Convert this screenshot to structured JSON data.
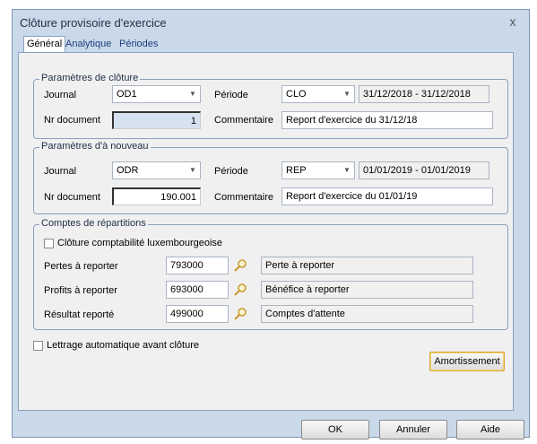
{
  "window": {
    "title": "Clôture provisoire d'exercice",
    "close": "x"
  },
  "tabs": [
    {
      "label": "Général",
      "active": true
    },
    {
      "label": "Analytique",
      "active": false
    },
    {
      "label": "Périodes",
      "active": false
    }
  ],
  "cloture": {
    "legend": "Paramètres de clôture",
    "journal_label": "Journal",
    "journal_value": "OD1",
    "periode_label": "Période",
    "periode_value": "CLO",
    "periode_range": "31/12/2018 - 31/12/2018",
    "nr_label": "Nr document",
    "nr_value": "1",
    "comment_label": "Commentaire",
    "comment_value": "Report d'exercice du 31/12/18"
  },
  "nouveau": {
    "legend": "Paramètres d'à nouveau",
    "journal_label": "Journal",
    "journal_value": "ODR",
    "periode_label": "Période",
    "periode_value": "REP",
    "periode_range": "01/01/2019 - 01/01/2019",
    "nr_label": "Nr document",
    "nr_value": "190.001",
    "comment_label": "Commentaire",
    "comment_value": "Report d'exercice du 01/01/19"
  },
  "repartitions": {
    "legend": "Comptes de répartitions",
    "lux_label": "Clôture comptabilité luxembourgeoise",
    "rows": [
      {
        "label": "Pertes à reporter",
        "account": "793000",
        "desc": "Perte à reporter"
      },
      {
        "label": "Profits à reporter",
        "account": "693000",
        "desc": "Bénéfice à reporter"
      },
      {
        "label": "Résultat reporté",
        "account": "499000",
        "desc": "Comptes d'attente"
      }
    ]
  },
  "lettrage_label": "Lettrage automatique avant clôture",
  "buttons": {
    "amort": "Amortissement",
    "ok": "OK",
    "annuler": "Annuler",
    "aide": "Aide"
  }
}
